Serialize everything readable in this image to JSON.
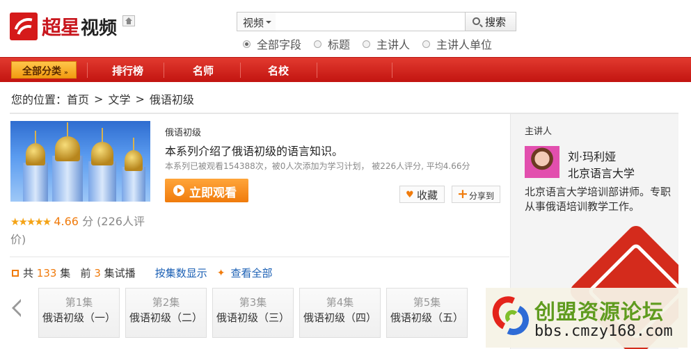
{
  "header": {
    "logo_cn": "超星",
    "logo_video": "视频",
    "search": {
      "scope": "视频",
      "input_value": "",
      "button": "搜索"
    },
    "radios": [
      {
        "label": "全部字段",
        "checked": true
      },
      {
        "label": "标题",
        "checked": false
      },
      {
        "label": "主讲人",
        "checked": false
      },
      {
        "label": "主讲人单位",
        "checked": false
      }
    ]
  },
  "nav": {
    "all_label": "全部分类",
    "items": [
      "排行榜",
      "名师",
      "名校"
    ]
  },
  "breadcrumb": {
    "prefix": "您的位置：",
    "items": [
      "首页",
      "文学",
      "俄语初级"
    ],
    "sep": ">"
  },
  "course": {
    "subtitle": "俄语初级",
    "description": "本系列介绍了俄语初级的语言知识。",
    "stats": "本系列已被观看154388次，被0人次添加为学习计划， 被226人评分, 平均4.66分",
    "watch_label": "立即观看",
    "fav_label": "收藏",
    "share_label": "分享到",
    "stars": "★★★★★",
    "score": "4.66",
    "score_unit": "分",
    "rating_count": "(226人评价)"
  },
  "episodes": {
    "total_prefix": "共",
    "total": "133",
    "total_suffix": "集",
    "trial_prefix": "前",
    "trial": "3",
    "trial_suffix": "集试播",
    "by_num": "按集数显示",
    "view_all": "查看全部",
    "cards": [
      {
        "num": "第1集",
        "title": "俄语初级（一）"
      },
      {
        "num": "第2集",
        "title": "俄语初级（二）"
      },
      {
        "num": "第3集",
        "title": "俄语初级（三）"
      },
      {
        "num": "第4集",
        "title": "俄语初级（四）"
      },
      {
        "num": "第5集",
        "title": "俄语初级（五）"
      }
    ]
  },
  "lecturer": {
    "label": "主讲人",
    "name": "刘·玛利娅",
    "org": "北京语言大学",
    "bio": "北京语言大学培训部讲师。专职从事俄语培训教学工作。"
  },
  "watermark": {
    "title": "创盟资源论坛",
    "url": "bbs.cmzy168.com"
  },
  "colors": {
    "brand_red": "#c8161d",
    "accent_orange": "#f07b0c",
    "link_blue": "#1a5fb4"
  }
}
